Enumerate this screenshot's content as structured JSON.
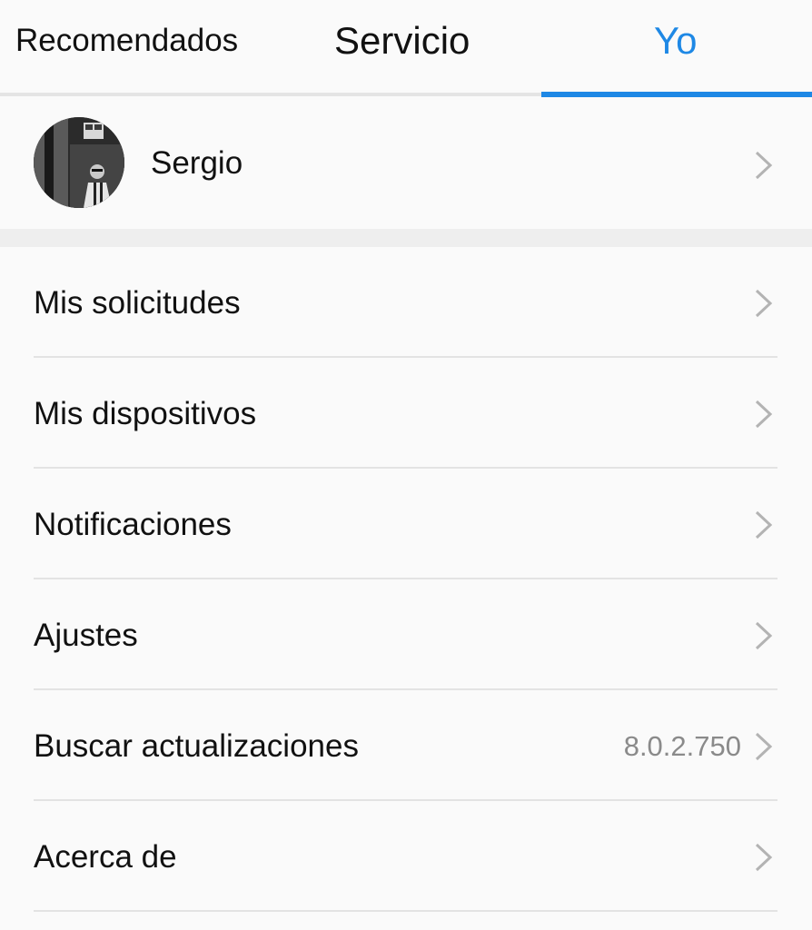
{
  "tabs": [
    {
      "label": "Recomendados",
      "active": false
    },
    {
      "label": "Servicio",
      "active": false
    },
    {
      "label": "Yo",
      "active": true
    }
  ],
  "accent_color": "#1e88e5",
  "profile": {
    "name": "Sergio",
    "avatar": "user-photo"
  },
  "menu": [
    {
      "label": "Mis solicitudes",
      "value": ""
    },
    {
      "label": "Mis dispositivos",
      "value": ""
    },
    {
      "label": "Notificaciones",
      "value": ""
    },
    {
      "label": "Ajustes",
      "value": ""
    },
    {
      "label": "Buscar actualizaciones",
      "value": "8.0.2.750"
    },
    {
      "label": "Acerca de",
      "value": ""
    }
  ],
  "icons": {
    "row_arrow": "chevron-right-icon"
  }
}
